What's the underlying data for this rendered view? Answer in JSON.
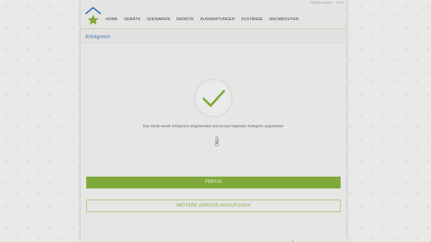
{
  "header": {
    "utility_links": [
      "EINSTELLUNGEN",
      "HILFE"
    ],
    "nav": [
      "HOME",
      "GERÄTE",
      "SZENARIEN",
      "DIENSTE",
      "AUSWERTUNGEN",
      "ZUSTÄNDE",
      "NACHRICHTEN"
    ],
    "logo_icon": "house-star-logo"
  },
  "subbar": {
    "title": "Erfolgreich"
  },
  "content": {
    "status_icon": "check-icon",
    "message": "Das Gerät wurde erfolgreich eingebunden und ist nun folgender Kategorie zugeordnet:",
    "category_icon": "thermometer-icon"
  },
  "actions": {
    "primary_label": "FERTIG",
    "secondary_label": "WEITERE GERÄTE HINZUFÜGEN"
  },
  "colors": {
    "accent_green": "#80a93b",
    "title_blue": "#4a7bb0",
    "logo_blue": "#3a72b5"
  }
}
